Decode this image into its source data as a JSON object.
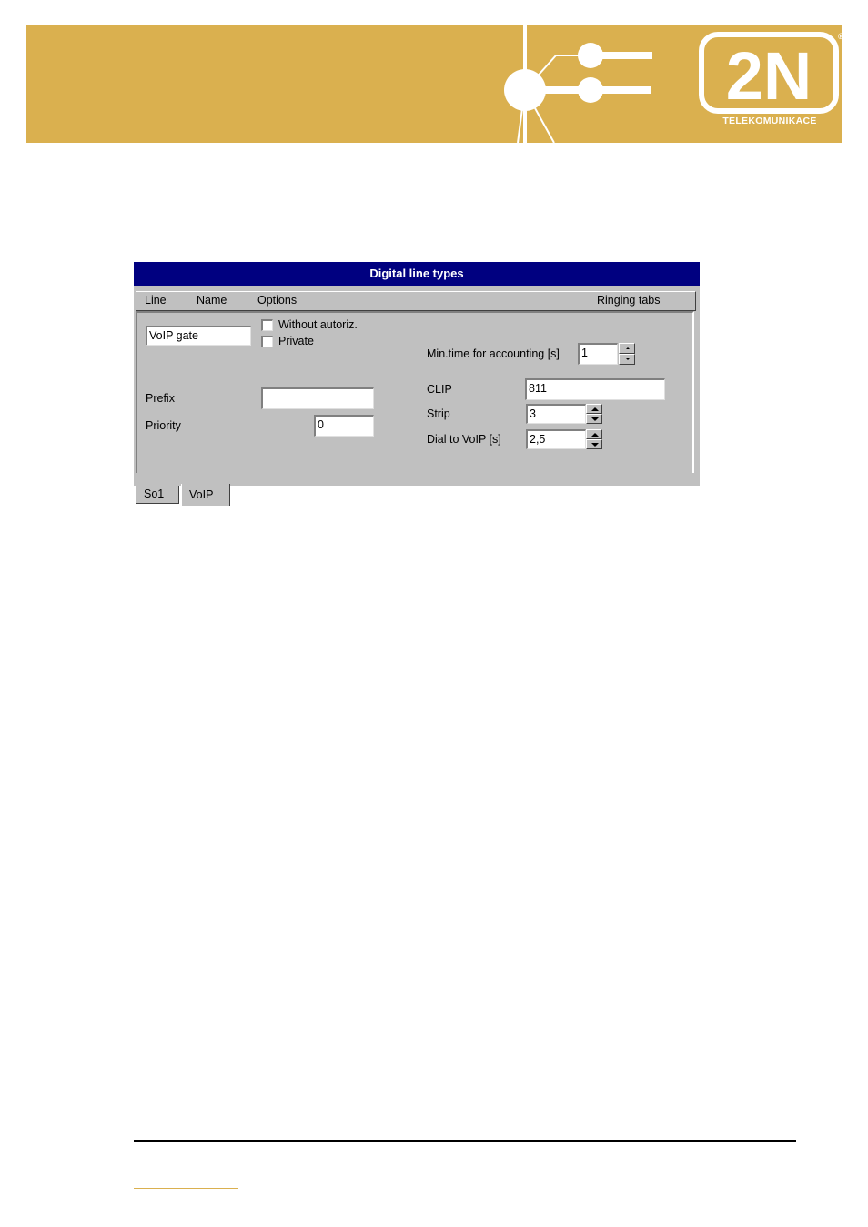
{
  "brand": {
    "logo_text": "2N",
    "tagline": "TELEKOMUNIKACE",
    "registered_mark": "®",
    "banner_color": "#dab04f"
  },
  "dialog": {
    "title": "Digital line types",
    "columns": {
      "line": "Line",
      "name": "Name",
      "options": "Options",
      "ringing_tabs": "Ringing tabs"
    },
    "name_value": "VoIP gate",
    "checkbox_without_autoriz": {
      "label": "Without autoriz.",
      "checked": false
    },
    "checkbox_private": {
      "label": "Private",
      "checked": false
    },
    "prefix": {
      "label": "Prefix",
      "value": ""
    },
    "priority": {
      "label": "Priority",
      "value": "0"
    },
    "min_time": {
      "label": "Min.time for accounting [s]",
      "value": "1"
    },
    "clip": {
      "label": "CLIP",
      "value": "811"
    },
    "strip": {
      "label": "Strip",
      "value": "3"
    },
    "dial_to_voip": {
      "label": "Dial to VoIP [s]",
      "value": "2,5"
    },
    "tabs": [
      {
        "label": "So1",
        "active": false
      },
      {
        "label": "VoIP",
        "active": true
      }
    ]
  }
}
